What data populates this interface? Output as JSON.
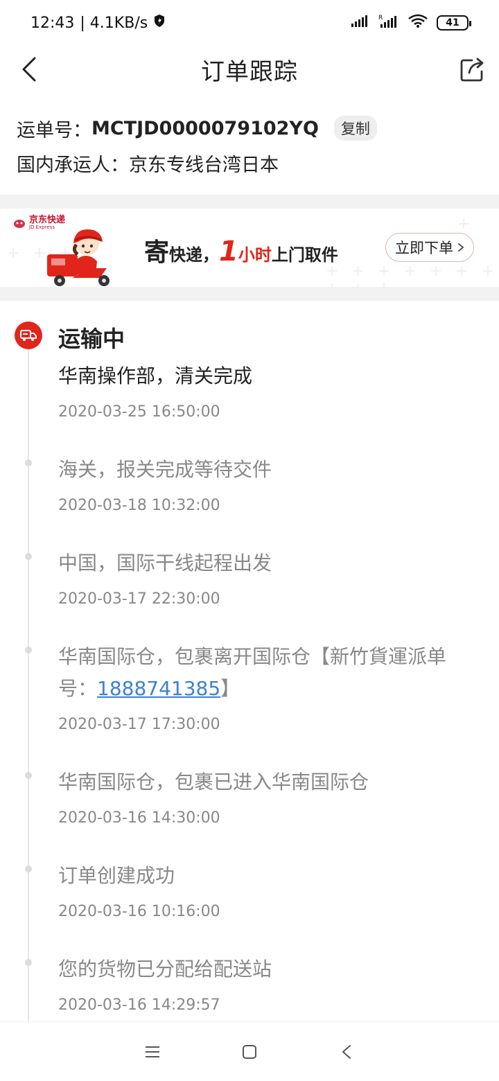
{
  "status_bar": {
    "time": "12:43",
    "speed": "| 4.1KB/s",
    "battery": "41"
  },
  "header": {
    "title": "订单跟踪",
    "icons": {
      "back": "chevron-left-icon",
      "share": "share-icon"
    }
  },
  "waybill": {
    "number_label": "运单号：",
    "number": "MCTJD0000079102YQ",
    "copy_label": "复制",
    "carrier_label": "国内承运人：",
    "carrier": "京东专线台湾日本"
  },
  "banner": {
    "brand_name": "京东快递",
    "brand_sub": "JD Express",
    "slogan_char1": "寄",
    "slogan_part2": "快递，",
    "slogan_num": "1",
    "slogan_part3": "小时",
    "slogan_part4": "上门取件",
    "button_label": "立即下单",
    "colors": {
      "accent": "#e1251b"
    }
  },
  "timeline": {
    "status": "运输中",
    "events": [
      {
        "desc": "华南操作部，清关完成",
        "time": "2020-03-25 16:50:00"
      },
      {
        "desc": "海关，报关完成等待交件",
        "time": "2020-03-18 10:32:00"
      },
      {
        "desc": "中国，国际干线起程出发",
        "time": "2020-03-17 22:30:00"
      },
      {
        "desc_prefix": "华南国际仓，包裹离开国际仓【新竹貨運派单号：",
        "link": "1888741385",
        "desc_suffix": "】",
        "time": "2020-03-17 17:30:00"
      },
      {
        "desc": "华南国际仓，包裹已进入华南国际仓",
        "time": "2020-03-16 14:30:00"
      },
      {
        "desc": "订单创建成功",
        "time": "2020-03-16 10:16:00"
      },
      {
        "desc": "您的货物已分配给配送站",
        "time": "2020-03-16 14:29:57"
      }
    ]
  },
  "navbar": {
    "icons": [
      "menu-icon",
      "home-square-icon",
      "back-triangle-icon"
    ]
  }
}
